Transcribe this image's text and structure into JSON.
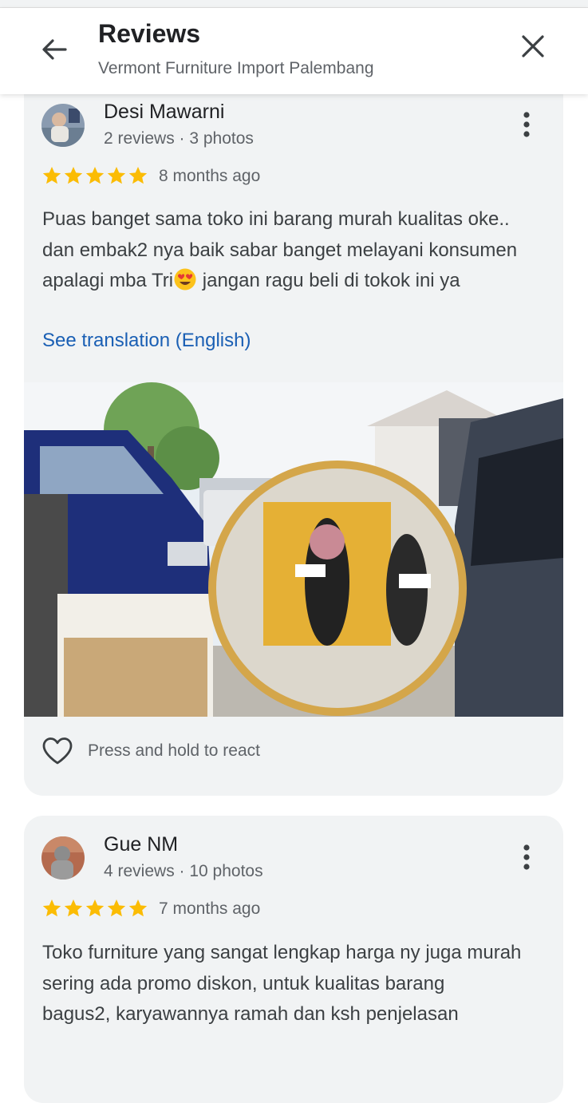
{
  "header": {
    "title": "Reviews",
    "subtitle": "Vermont Furniture Import Palembang"
  },
  "reviews": [
    {
      "name": "Desi Mawarni",
      "meta": "2 reviews · 3 photos",
      "rating": 5,
      "time": "8 months ago",
      "text_before_emoji": "Puas banget sama toko ini barang murah kualitas oke.. dan embak2 nya baik sabar banget melayani konsumen apalagi mba Tri",
      "emoji": "smiling-face-with-heart-eyes",
      "text_after_emoji": " jangan ragu beli di tokok ini ya",
      "translation_link": "See translation (English)",
      "react_label": "Press and hold to react"
    },
    {
      "name": "Gue NM",
      "meta": "4 reviews · 10 photos",
      "rating": 5,
      "time": "7 months ago",
      "text": "Toko furniture yang sangat lengkap harga ny juga murah sering ada promo diskon, untuk kualitas barang\nbagus2, karyawannya ramah dan ksh penjelasan"
    }
  ],
  "colors": {
    "star": "#fbbc04",
    "link": "#1a5fb4",
    "card_bg": "#f1f3f4"
  }
}
